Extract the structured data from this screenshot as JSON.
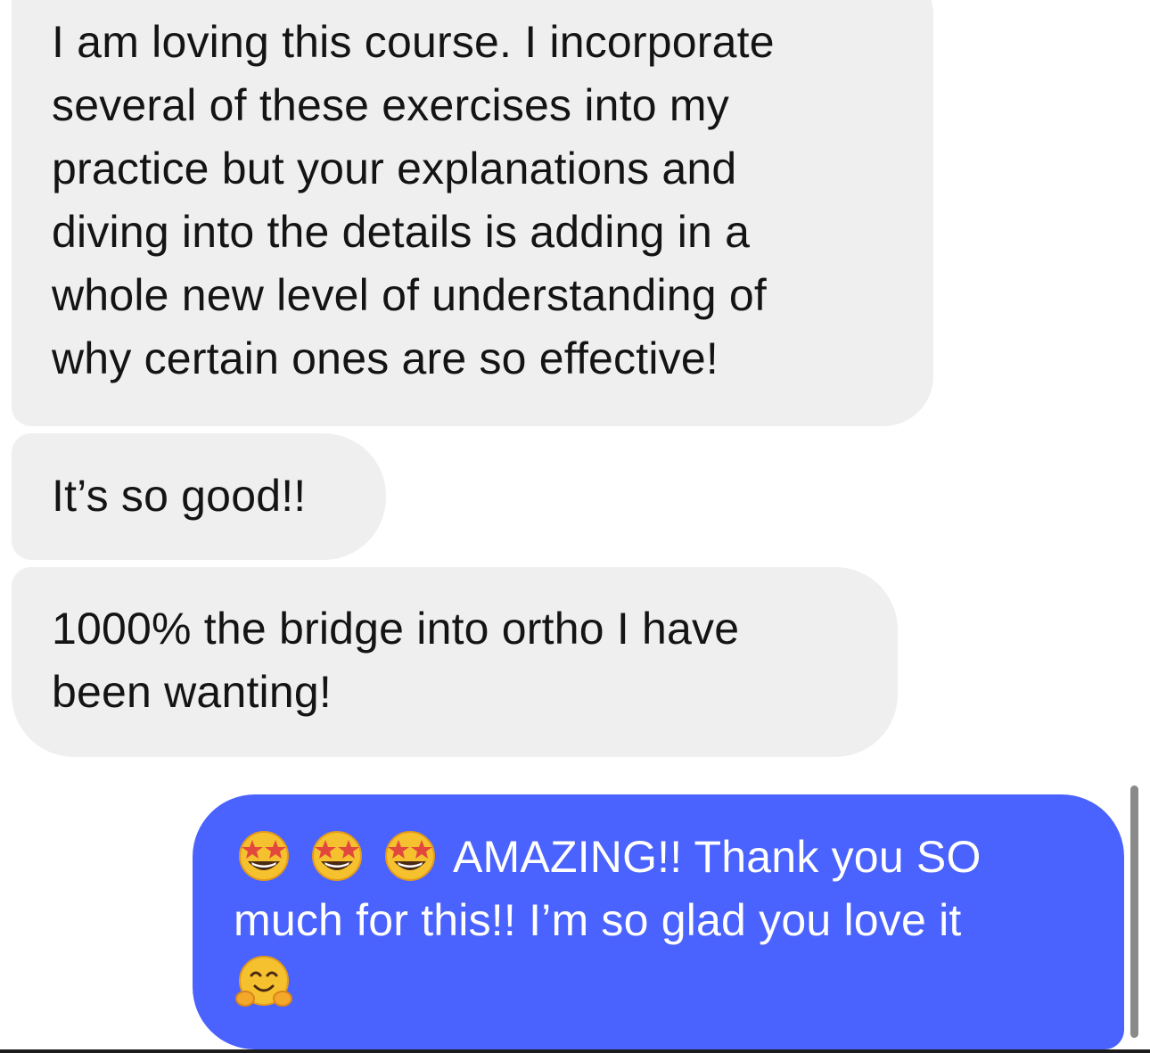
{
  "messages": [
    {
      "direction": "incoming",
      "lines": [
        "I am loving this course. I incorporate",
        "several of these exercises into my",
        "practice but your explanations and",
        "diving into the details is adding in a",
        "whole new level of understanding of",
        "why certain ones are so effective!"
      ]
    },
    {
      "direction": "incoming",
      "lines": [
        "It’s so good!!"
      ]
    },
    {
      "direction": "incoming",
      "lines": [
        "1000% the bridge into ortho I have",
        "been wanting!"
      ]
    },
    {
      "direction": "outgoing",
      "line1_text": "AMAZING!! Thank you SO",
      "line2_text": "much for this!! I’m so glad you love it",
      "emojis": [
        "star-struck-emoji",
        "star-struck-emoji",
        "star-struck-emoji",
        "hugging-face-emoji"
      ]
    }
  ],
  "colors": {
    "incoming_bubble": "#efefef",
    "outgoing_bubble": "#4a62fe",
    "incoming_text": "#141414",
    "outgoing_text": "#ffffff"
  }
}
